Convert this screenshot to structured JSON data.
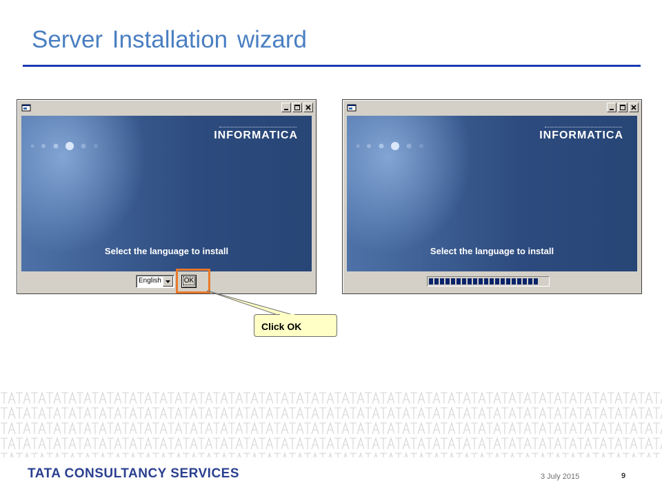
{
  "slide": {
    "title": "Server Installation wizard"
  },
  "dialogs": [
    {
      "logo": "INFORMATICA",
      "caption": "Select the language to install",
      "language_value": "English",
      "ok_label": "OK"
    },
    {
      "logo": "INFORMATICA",
      "caption": "Select the language to install",
      "progress_segments": 20
    }
  ],
  "callout": {
    "text": "Click OK"
  },
  "footer": {
    "brand": "TATA CONSULTANCY SERVICES",
    "date": "3 July 2015",
    "page": "9"
  },
  "colors": {
    "title": "#4a7fc1",
    "rule": "#1a3bb2",
    "highlight": "#e8792b",
    "callout_fill": "#ffffc6",
    "brand": "#2a3f8f"
  },
  "icons": {
    "window_icon": "installer-icon",
    "minimize": "minimize-icon",
    "maximize": "maximize-icon",
    "close": "close-icon",
    "dropdown": "chevron-down-icon"
  }
}
